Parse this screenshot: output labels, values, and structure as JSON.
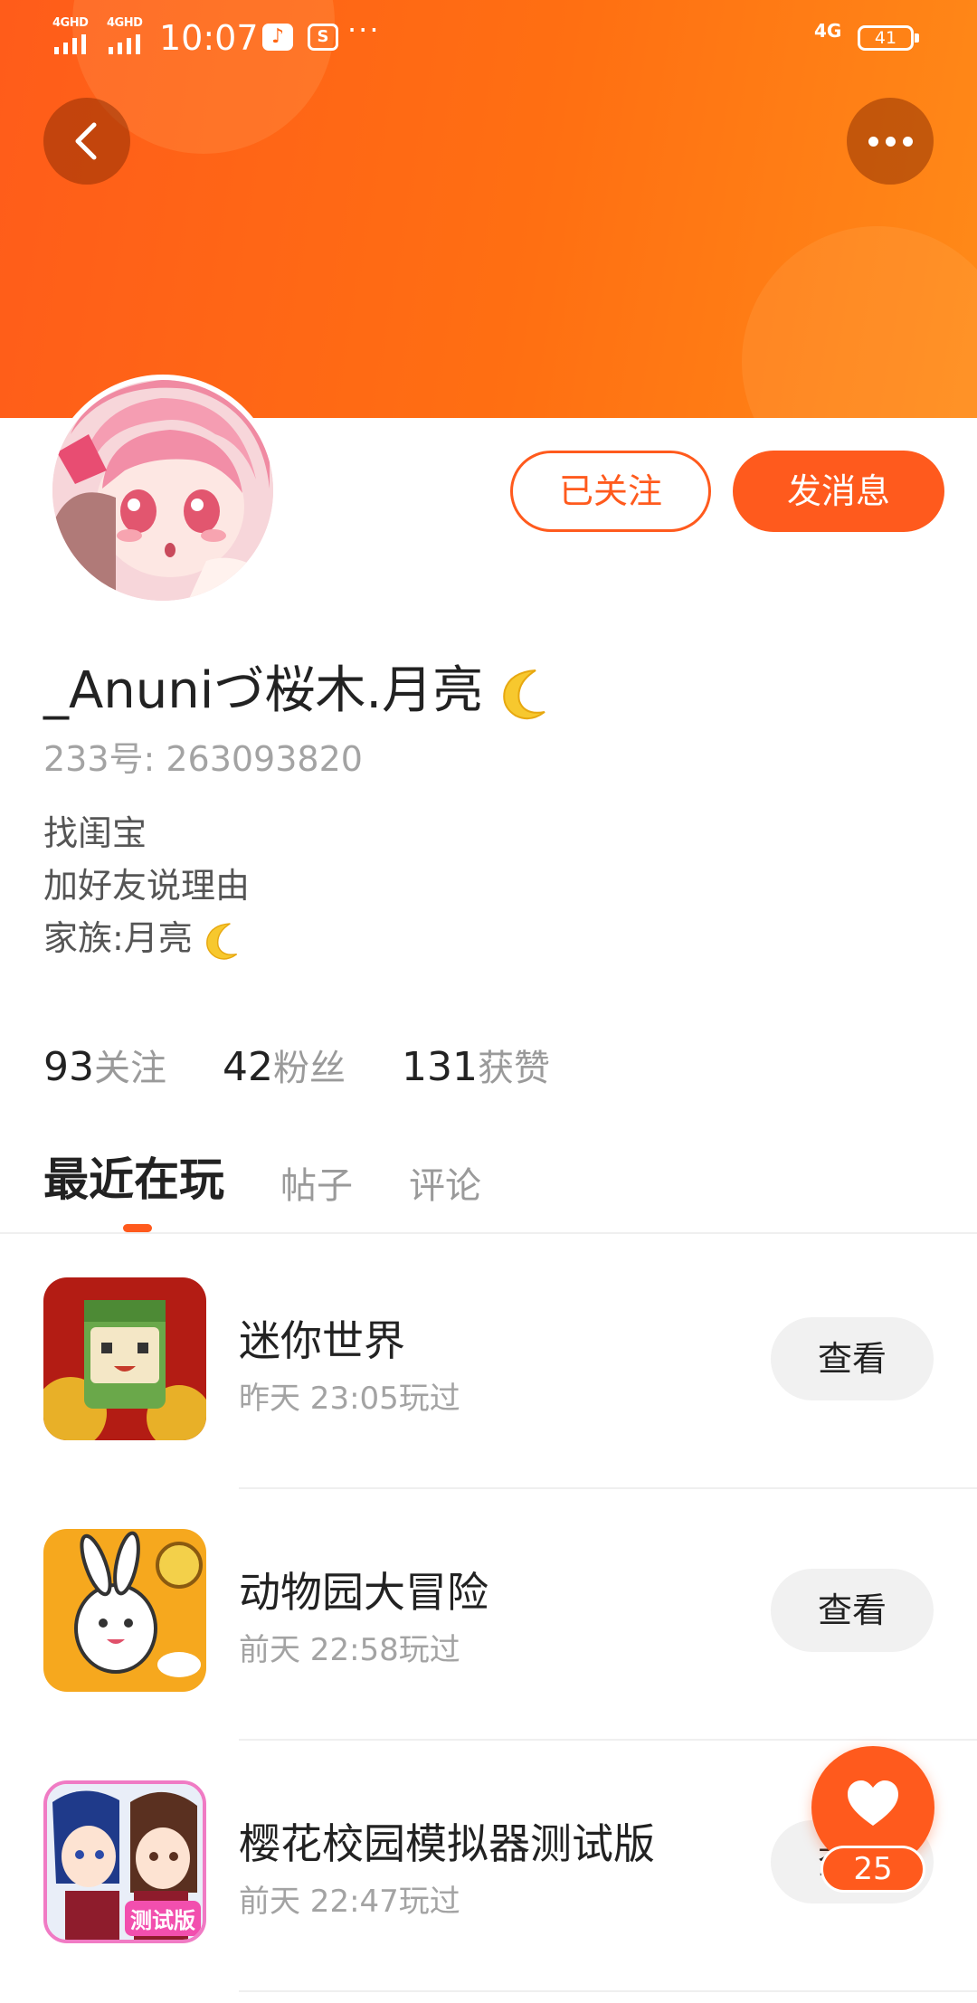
{
  "status_bar": {
    "sim1_label": "4GHD",
    "sim2_label": "4GHD",
    "time": "10:07",
    "overflow": "···",
    "network_label": "4G",
    "battery_level": "41"
  },
  "header": {
    "back_icon": "chevron-left-icon",
    "more_icon": "more-dots-icon"
  },
  "profile": {
    "nickname": "_Anuniづ桜木.月亮",
    "uid_label": "233号:",
    "uid_value": "263093820",
    "bio_lines": [
      "找闺宝",
      "加好友说理由",
      "家族:月亮"
    ],
    "follow_button": "已关注",
    "message_button": "发消息"
  },
  "stats": {
    "following_count": "93",
    "following_label": "关注",
    "followers_count": "42",
    "followers_label": "粉丝",
    "likes_count": "131",
    "likes_label": "获赞"
  },
  "tabs": {
    "items": [
      "最近在玩",
      "帖子",
      "评论"
    ],
    "active": "最近在玩"
  },
  "games": [
    {
      "name": "迷你世界",
      "time": "昨天 23:05玩过",
      "action": "查看"
    },
    {
      "name": "动物园大冒险",
      "time": "前天 22:58玩过",
      "action": "查看"
    },
    {
      "name": "樱花校园模拟器测试版",
      "time": "前天 22:47玩过",
      "action": "查看",
      "icon_badge": "测试版"
    }
  ],
  "like_fab": {
    "icon": "heart-icon",
    "count": "25"
  },
  "colors": {
    "brand": "#ff5a1d",
    "banner": "#ff6f12"
  }
}
